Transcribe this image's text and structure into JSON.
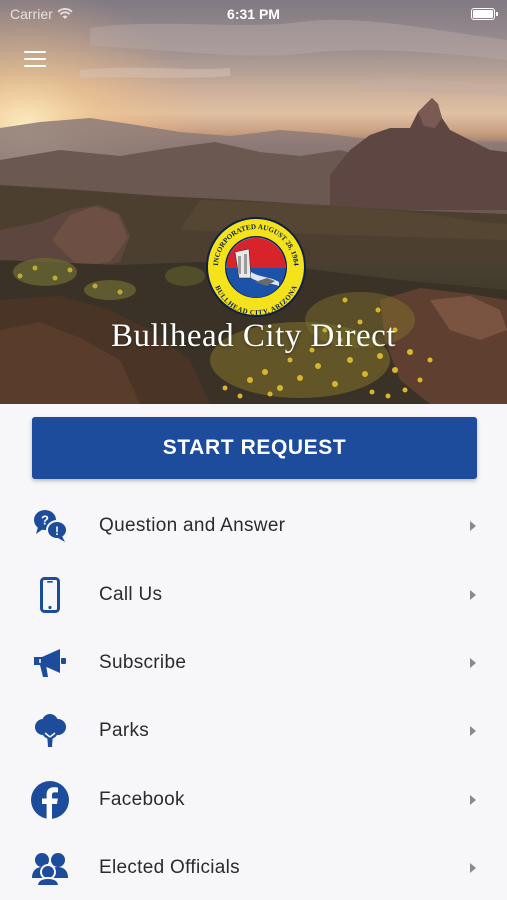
{
  "status_bar": {
    "carrier": "Carrier",
    "time": "6:31 PM"
  },
  "hero": {
    "app_title": "Bullhead City Direct",
    "seal": {
      "top_text": "INCORPORATED AUGUST 28, 1984",
      "bottom_text": "BULLHEAD CITY, ARIZONA"
    }
  },
  "start_request": {
    "label": "START REQUEST"
  },
  "menu": {
    "items": [
      {
        "label": "Question and Answer",
        "icon": "question-answer-icon"
      },
      {
        "label": "Call Us",
        "icon": "phone-icon"
      },
      {
        "label": "Subscribe",
        "icon": "megaphone-icon"
      },
      {
        "label": "Parks",
        "icon": "tree-icon"
      },
      {
        "label": "Facebook",
        "icon": "facebook-icon"
      },
      {
        "label": "Elected Officials",
        "icon": "people-icon"
      }
    ]
  },
  "colors": {
    "accent": "#1d4c9c",
    "icon": "#1d4c9c",
    "seal_yellow": "#f4e21a",
    "seal_red": "#d8232a",
    "seal_blue": "#1c53a8"
  }
}
